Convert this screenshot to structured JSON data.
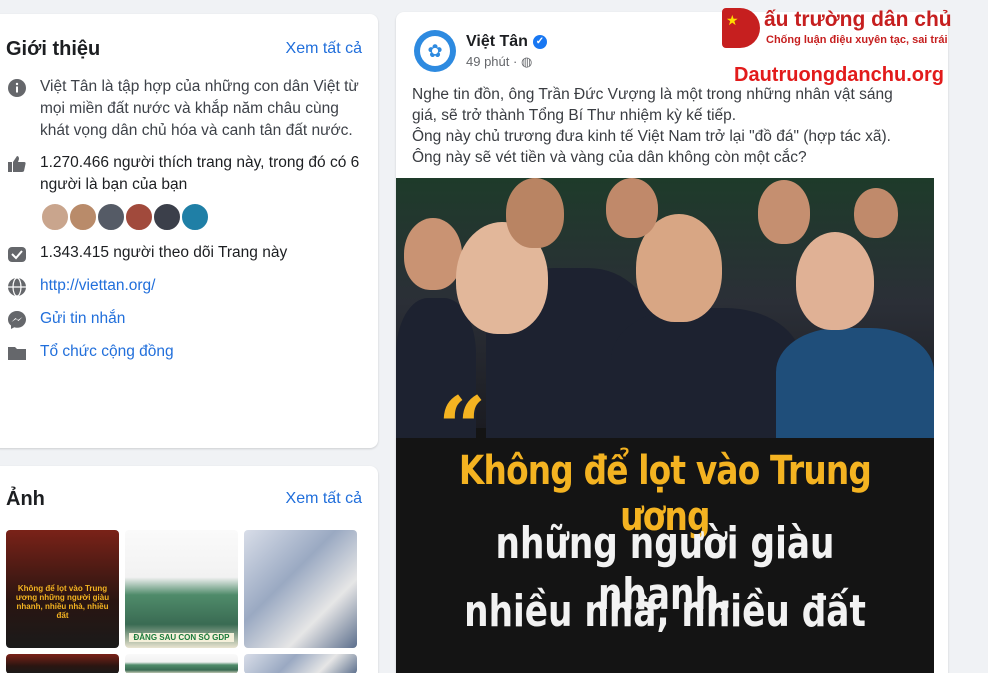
{
  "intro": {
    "title": "Giới thiệu",
    "see_all": "Xem tất cả",
    "description": "Việt Tân là tập hợp của những con dân Việt từ mọi miền đất nước và khắp năm châu cùng khát vọng dân chủ hóa và canh tân đất nước.",
    "likes": "1.270.466 người thích trang này, trong đó có 6 người là bạn của bạn",
    "followers": "1.343.415 người theo dõi Trang này",
    "website": "http://viettan.org/",
    "message": "Gửi tin nhắn",
    "category": "Tổ chức cộng đồng",
    "friend_colors": [
      "#c9a58d",
      "#b98b6a",
      "#555b66",
      "#a14a3c",
      "#3b3f4a",
      "#1f7fa6"
    ]
  },
  "photos": {
    "title": "Ảnh",
    "see_all": "Xem tất cả",
    "thumb1_caption": "Không để lọt vào Trung ương những người giàu nhanh, nhiều nhà, nhiều đất",
    "thumb2_caption": "ĐẰNG SAU CON SỐ GDP"
  },
  "post": {
    "page_name": "Việt Tân",
    "time": "49 phút · ",
    "text_lines": [
      "Nghe tin đồn, ông Trần Đức Vượng là một trong những nhân vật sáng",
      "giá, sẽ trở thành Tổng Bí Thư nhiệm kỳ kế tiếp.",
      "Ông này chủ trương đưa kinh tế Việt Nam trở lại \"đồ đá\" (hợp tác xã).",
      "Ông này sẽ vét tiền và vàng của dân không còn một cắc?"
    ],
    "image_headline_1": "Không để lọt vào Trung ương",
    "image_headline_2": "những người giàu nhanh,",
    "image_headline_3": "nhiều nhà, nhiều đất"
  },
  "watermark": {
    "title": "ấu trường dân chủ",
    "subtitle": "Chống luận điệu xuyên tạc, sai trái",
    "url": "Dautruongdanchu.org"
  },
  "colors": {
    "link": "#216fdb",
    "accent_yellow": "#f4b321",
    "brand_red": "#c61f1f"
  }
}
